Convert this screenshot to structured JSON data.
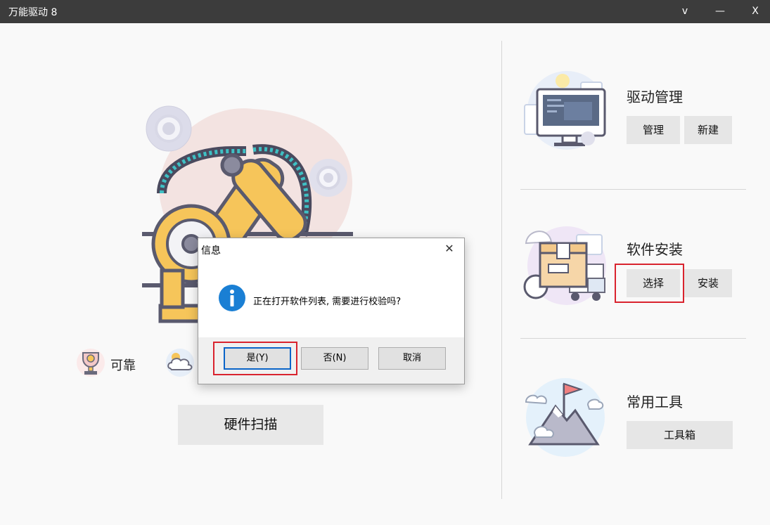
{
  "window": {
    "title": "万能驱动 8",
    "btn_collapse": "v",
    "btn_min": "—",
    "btn_close": "X"
  },
  "sections": {
    "driver": {
      "title": "驱动管理",
      "btn_manage": "管理",
      "btn_new": "新建"
    },
    "software": {
      "title": "软件安装",
      "btn_select": "选择",
      "btn_install": "安装"
    },
    "tools": {
      "title": "常用工具",
      "btn_toolbox": "工具箱"
    }
  },
  "features": {
    "reliable": "可靠"
  },
  "scan": {
    "label": "硬件扫描"
  },
  "dialog": {
    "title": "信息",
    "close": "✕",
    "message": "正在打开软件列表, 需要进行校验吗?",
    "btn_yes": "是(Y)",
    "btn_no": "否(N)",
    "btn_cancel": "取消"
  },
  "colors": {
    "titlebar": "#3c3c3c",
    "highlight": "#d9232e",
    "info_icon": "#1a7fd4"
  }
}
